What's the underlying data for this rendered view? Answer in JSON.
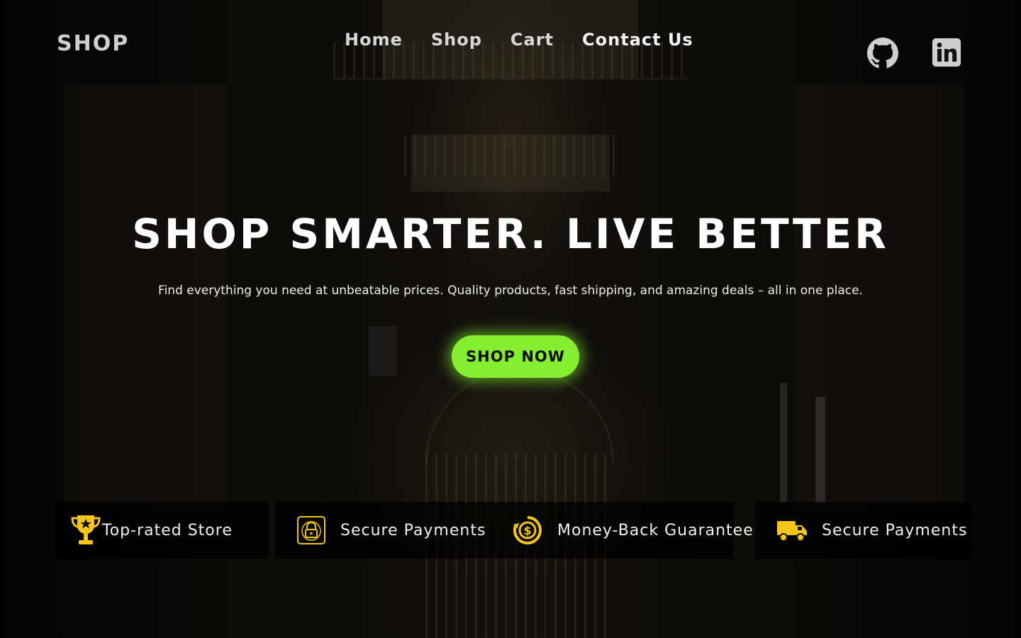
{
  "brand": {
    "logo": "SHOP"
  },
  "nav": {
    "items": [
      {
        "label": "Home"
      },
      {
        "label": "Shop"
      },
      {
        "label": "Cart"
      },
      {
        "label": "Contact Us"
      }
    ]
  },
  "social": {
    "github_icon": "github-icon",
    "linkedin_icon": "linkedin-icon"
  },
  "hero": {
    "title": "SHOP SMARTER. LIVE BETTER",
    "subtitle": "Find everything you need at unbeatable prices. Quality products, fast shipping, and amazing deals – all in one place.",
    "cta_label": "SHOP NOW",
    "cta_color": "#84ee2f"
  },
  "features": [
    {
      "icon": "trophy-icon",
      "label": "Top-rated Store"
    },
    {
      "icon": "lock-icon",
      "label": "Secure Payments"
    },
    {
      "icon": "dollar-coin-icon",
      "label": "Money-Back Guarantee"
    },
    {
      "icon": "truck-icon",
      "label": "Secure Payments"
    }
  ],
  "accent_icon_color": "#f5c518"
}
